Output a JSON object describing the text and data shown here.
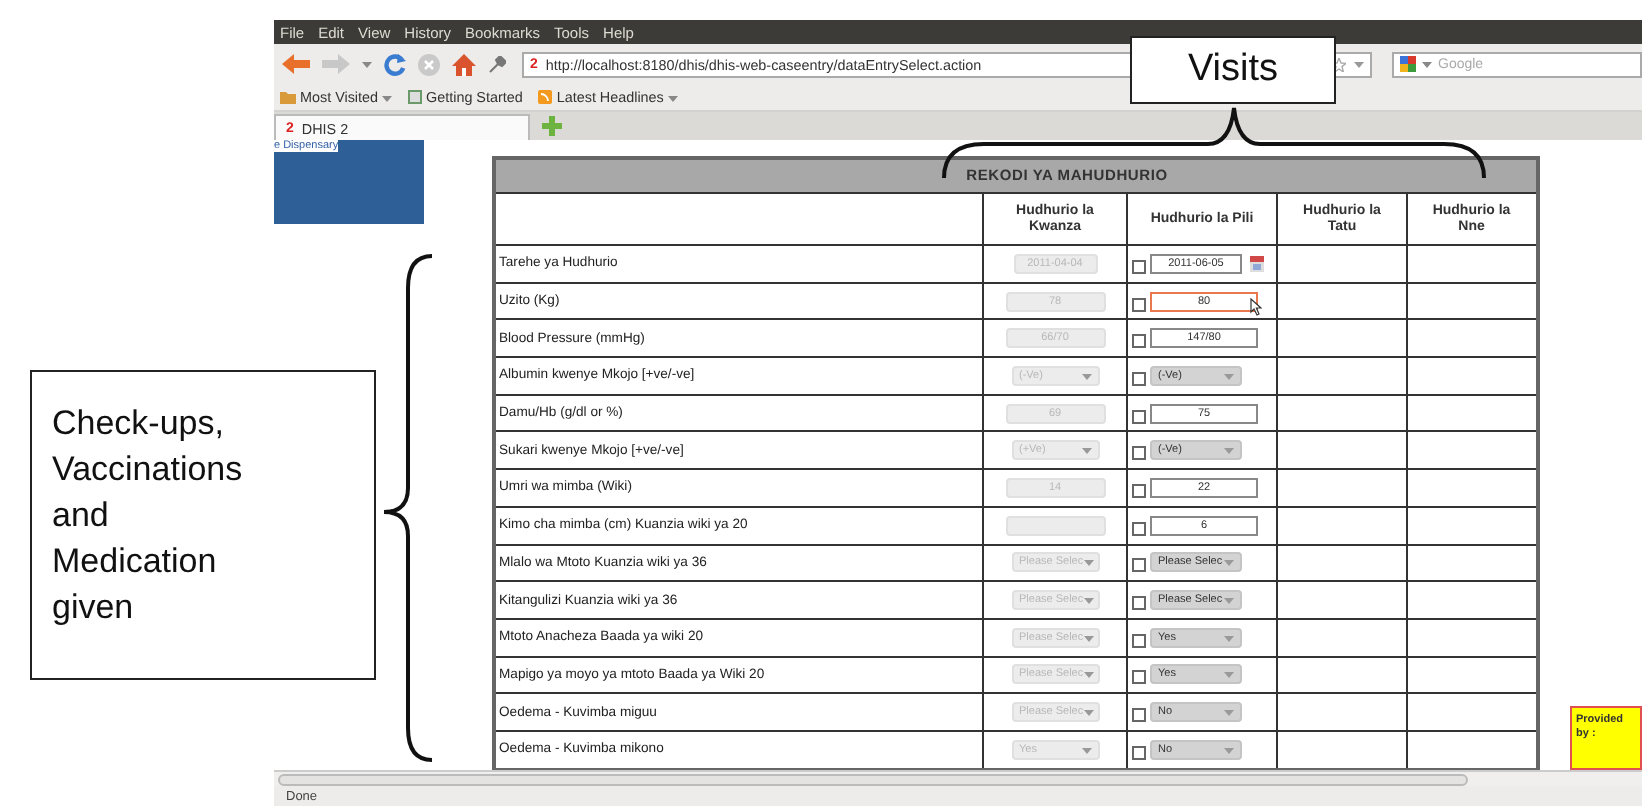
{
  "browser": {
    "menu": [
      "File",
      "Edit",
      "View",
      "History",
      "Bookmarks",
      "Tools",
      "Help"
    ],
    "url_icon": "2",
    "url": "http://localhost:8180/dhis/dhis-web-caseentry/dataEntrySelect.action",
    "search": {
      "placeholder": "Google"
    },
    "bookmarks": [
      {
        "label": "Most Visited",
        "kind": "folder",
        "dropdown": true
      },
      {
        "label": "Getting Started",
        "kind": "page",
        "dropdown": false
      },
      {
        "label": "Latest Headlines",
        "kind": "feed",
        "dropdown": true
      }
    ],
    "tabs": [
      {
        "icon": "2",
        "label": "DHIS 2",
        "selected": true
      }
    ],
    "status_bar": "Done"
  },
  "sidebar": {
    "org_unit": "e Dispensary"
  },
  "form": {
    "title": "REKODI YA MAHUDHURIO",
    "columns": [
      "Hudhurio la Kwanza",
      "Hudhurio la Pili",
      "Hudhurio la Tatu",
      "Hudhurio la Nne"
    ],
    "rows": [
      {
        "label": "Tarehe ya Hudhurio",
        "kind": "date",
        "first": "2011-04-04",
        "second": "2011-06-05",
        "checked": false,
        "focused": false
      },
      {
        "label": "Uzito (Kg)",
        "kind": "text",
        "first": "78",
        "second": "80",
        "checked": false,
        "focused": true
      },
      {
        "label": "Blood Pressure (mmHg)",
        "kind": "text",
        "first": "66/70",
        "second": "147/80",
        "checked": false,
        "focused": false
      },
      {
        "label": "Albumin kwenye Mkojo [+ve/-ve]",
        "kind": "select",
        "first": "(-Ve)",
        "second": "(-Ve)",
        "checked": false,
        "focused": false
      },
      {
        "label": "Damu/Hb (g/dl or %)",
        "kind": "text",
        "first": "69",
        "second": "75",
        "checked": false,
        "focused": false
      },
      {
        "label": "Sukari kwenye Mkojo [+ve/-ve]",
        "kind": "select",
        "first": "(+Ve)",
        "second": "(-Ve)",
        "checked": false,
        "focused": false
      },
      {
        "label": "Umri wa mimba (Wiki)",
        "kind": "text",
        "first": "14",
        "second": "22",
        "checked": false,
        "focused": false
      },
      {
        "label": "Kimo cha mimba (cm) Kuanzia wiki ya 20",
        "kind": "text",
        "second": "6",
        "checked": false,
        "focused": false
      },
      {
        "label": "Mlalo wa Mtoto Kuanzia wiki ya 36",
        "kind": "select",
        "first": "Please Selec",
        "second": "Please Selec",
        "checked": false,
        "focused": false
      },
      {
        "label": "Kitangulizi Kuanzia wiki ya 36",
        "kind": "select",
        "first": "Please Selec",
        "second": "Please Selec",
        "checked": false,
        "focused": false
      },
      {
        "label": "Mtoto Anacheza Baada ya wiki 20",
        "kind": "select",
        "first": "Please Selec",
        "second": "Yes",
        "checked": false,
        "focused": false
      },
      {
        "label": "Mapigo ya moyo ya mtoto Baada ya Wiki 20",
        "kind": "select",
        "first": "Please Selec",
        "second": "Yes",
        "checked": false,
        "focused": false
      },
      {
        "label": "Oedema - Kuvimba miguu",
        "kind": "select",
        "first": "Please Selec",
        "second": "No",
        "checked": false,
        "focused": false
      },
      {
        "label": "Oedema - Kuvimba mikono",
        "kind": "select",
        "first": "Yes",
        "second": "No",
        "checked": false,
        "focused": false
      }
    ]
  },
  "note": {
    "text": "Provided by :"
  },
  "annotations": [
    {
      "kind": "top",
      "text": "Visits"
    },
    {
      "kind": "left",
      "text": "Check-ups, Vaccinations and Medication given"
    }
  ]
}
